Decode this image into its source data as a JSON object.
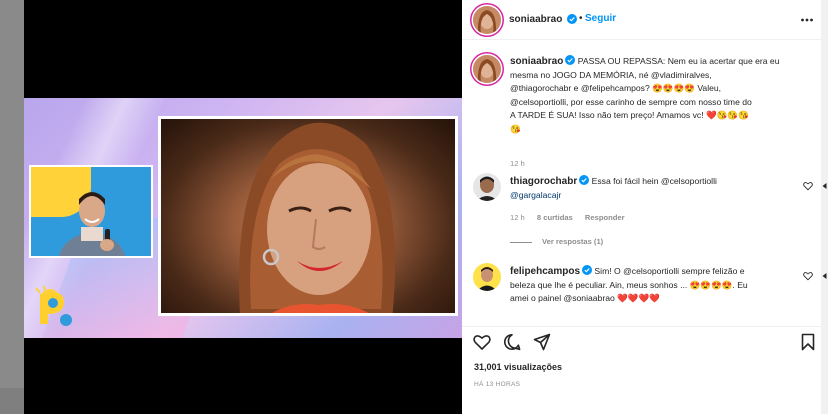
{
  "post": {
    "author": "soniaabrao",
    "follow_label": "Seguir",
    "separator": "•",
    "caption_lines": [
      "PASSA OU REPASSA: Nem eu ia acertar que era eu",
      "mesma no JOGO DA MEMÓRIA, né @vladimiralves,",
      "@thiagorochabr e @felipehcampos? 😍😍😍😍 Valeu,",
      "@celsoportiolli, por esse carinho de sempre com nosso time do",
      "A TARDE É SUA! Isso não tem preço! Amamos vc! ❤️😘😘😘",
      "😘"
    ],
    "caption_time": "12 h"
  },
  "comments": [
    {
      "author": "thiagorochabr",
      "lines": [
        "Essa foi fácil hein @celsoportiolli",
        "@gargalacajr"
      ],
      "time": "12 h",
      "likes": "8 curtidas",
      "reply_label": "Responder",
      "view_replies": "Ver respostas (1)"
    },
    {
      "author": "felipehcampos",
      "lines": [
        "Sim! O @celsoportiolli sempre felizão e",
        "beleza que lhe é peculiar. Ain, meus sonhos ... 😍😍😍😍. Eu",
        "amei o painel @soniaabrao ❤️❤️❤️❤️"
      ]
    }
  ],
  "stats": {
    "views": "31,001 visualizações",
    "time_ago": "HÁ 13 HORAS"
  },
  "icons": {
    "more": "more-options-icon",
    "verified": "verified-badge-icon",
    "like": "heart-icon",
    "comment": "comment-icon",
    "share": "share-icon",
    "save": "bookmark-icon",
    "nav": "chevron-left-icon"
  },
  "colors": {
    "link": "#00376b",
    "follow": "#0095f6",
    "verified": "#0095f6",
    "meta": "#8e8e8e"
  }
}
